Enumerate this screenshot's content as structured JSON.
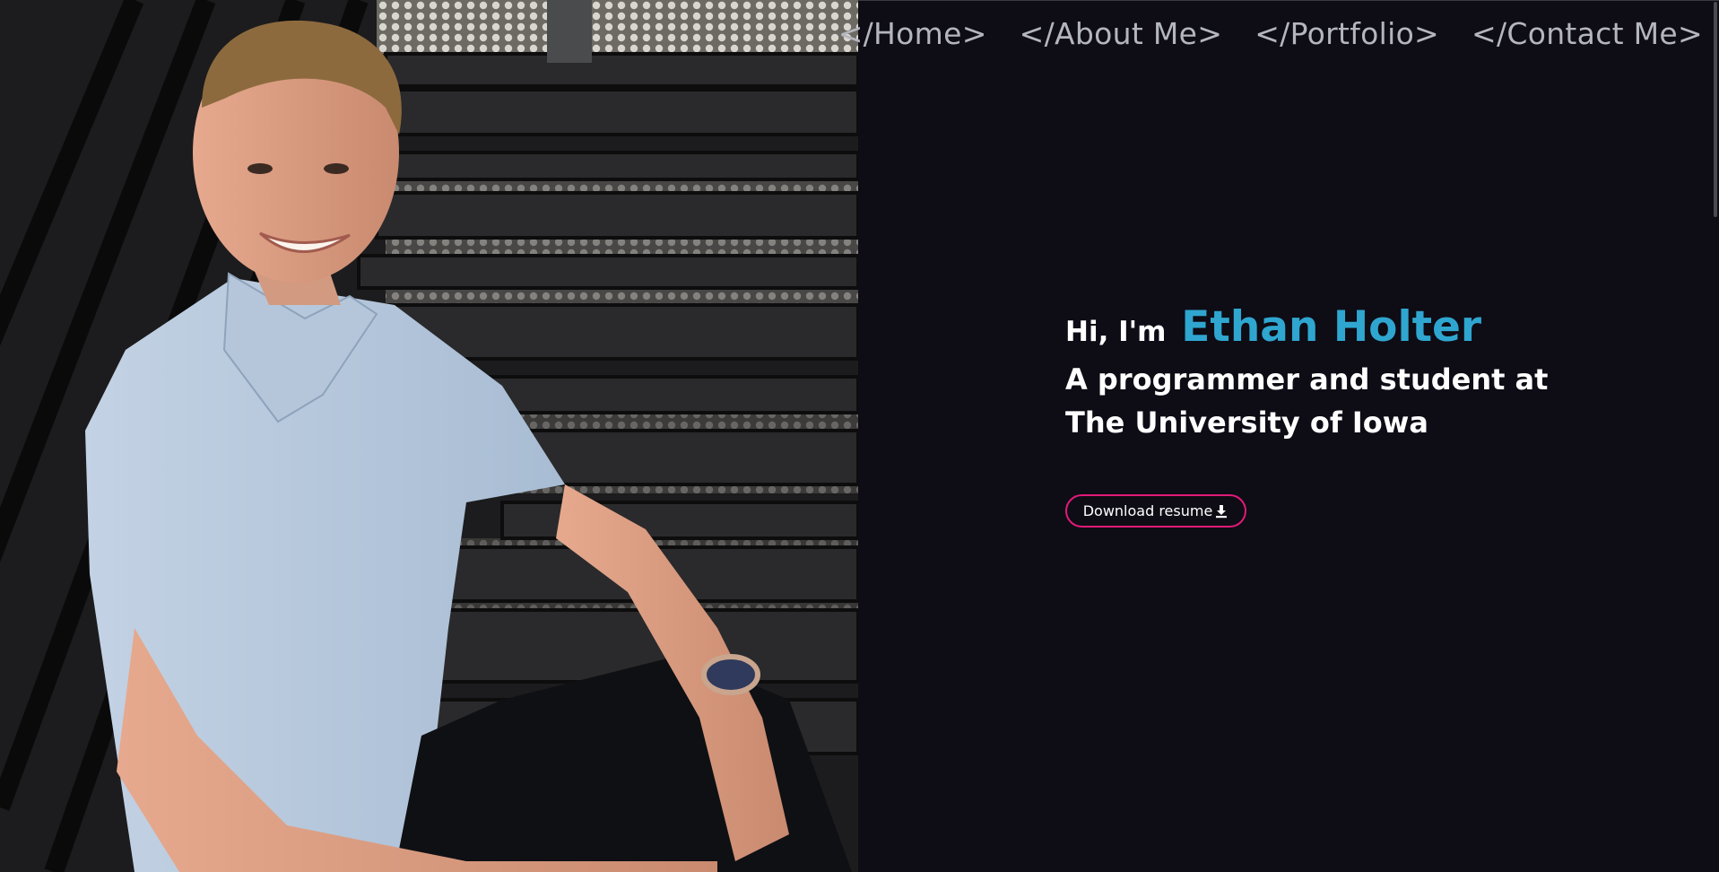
{
  "nav": {
    "items": [
      "</Home>",
      "</About Me>",
      "</Portfolio>",
      "</Contact Me>"
    ]
  },
  "hero": {
    "greeting": "Hi, I'm",
    "name": "Ethan Holter",
    "tagline_line1": "A programmer and student at",
    "tagline_line2": "The University of Iowa"
  },
  "resume_button": {
    "label": "Download resume",
    "icon": "download-icon"
  },
  "photo": {
    "icon": "portrait-photo"
  },
  "colors": {
    "background": "#0e0c15",
    "accent_name": "#2fa6d0",
    "button_border": "#e11a79",
    "nav_text": "#b4b6bd"
  }
}
